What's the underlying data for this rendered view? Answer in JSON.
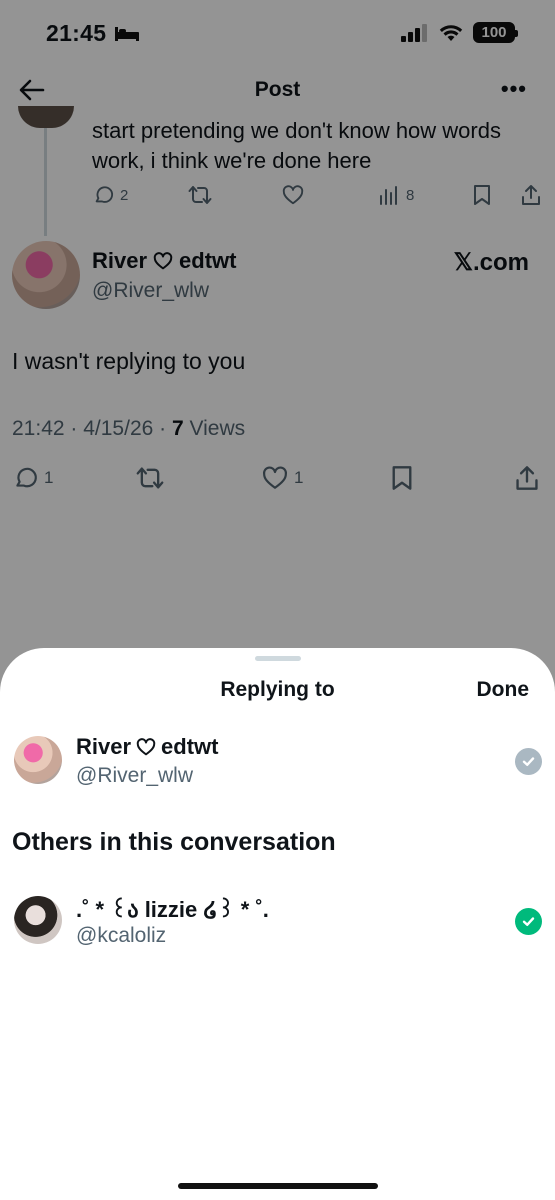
{
  "status_bar": {
    "time": "21:45",
    "battery": "100"
  },
  "nav": {
    "title": "Post"
  },
  "previous_post": {
    "text": "start pretending we don't know how words work, i think we're done here",
    "replies": "2",
    "views": "8"
  },
  "post": {
    "author_name": "River",
    "author_tag": "edtwt",
    "handle": "@River_wlw",
    "source": "𝕏.com",
    "text": "I wasn't replying to you",
    "time": "21:42",
    "date": "4/15/26",
    "views_count": "7",
    "views_label": "Views",
    "replies": "1",
    "likes": "1"
  },
  "sheet": {
    "title": "Replying to",
    "done_label": "Done",
    "primary": {
      "name": "River",
      "tag": "edtwt",
      "handle": "@River_wlw",
      "checked": true,
      "check_color": "#aab8c2"
    },
    "others_heading": "Others in this conversation",
    "others": [
      {
        "name": ".˚ * ꒰ა lizzie ໒꒱ * ˚.",
        "handle": "@kcaloliz",
        "checked": true,
        "check_color": "#00ba7c"
      }
    ]
  },
  "colors": {
    "text": "#0f1419",
    "secondary": "#536471",
    "green": "#00ba7c"
  }
}
